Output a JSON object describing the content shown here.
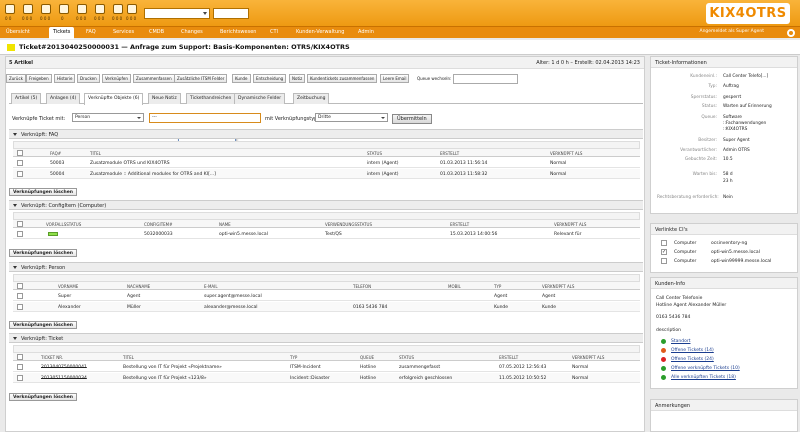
{
  "toolbar": {
    "icons": [
      {
        "name": "locked-tickets-icon",
        "count": "0 0"
      },
      {
        "name": "watched-tickets-icon",
        "count": "0 0 0"
      },
      {
        "name": "responsible-tickets-icon",
        "count": "0 0 0"
      },
      {
        "name": "escalated-tickets-icon",
        "count": "0"
      },
      {
        "name": "new-phone-ticket-icon",
        "count": "0 0 0"
      },
      {
        "name": "new-email-ticket-icon",
        "count": "0 0 0"
      },
      {
        "name": "search-tickets-icon",
        "count": "0 0 0"
      },
      {
        "name": "reminder-tickets-icon",
        "count": "0 0 0"
      }
    ],
    "select_value": "",
    "search_value": ""
  },
  "logo": "KIX4OTRS",
  "nav": {
    "items": [
      "Übersicht",
      "Tickets",
      "FAQ",
      "Services",
      "CMDB",
      "Changes",
      "Berichtswesen",
      "CTI",
      "Kunden-Verwaltung",
      "Admin"
    ],
    "active": "Tickets",
    "user": "Angemeldet als Super Agent"
  },
  "ticket": {
    "title": "Ticket#2013040250000031 — Anfrage zum Support: Basis-Komponenten: OTRS/KIX4OTRS",
    "articles_label": "5 Artikel",
    "age_info": "Alter: 1 d 0 h – Erstellt: 02.04.2013 14:23"
  },
  "actions": [
    "Zurück",
    "Freigeben",
    "Historie",
    "Drucken",
    "Verknüpfen",
    "Zusammenfassen",
    "Zusätzliche ITSM Felder",
    "Kunde",
    "Entscheidung",
    "Notiz",
    "Kundentickets zusammenfassen",
    "Leere Email"
  ],
  "queue": {
    "label": "Queue wechseln:",
    "value": ""
  },
  "tabs": [
    "Artikel (5)",
    "Anlagen (4)",
    "Verknüpfte Objekte (6)",
    "Neue Notiz",
    "Tickethandreichen",
    "Dynamische Felder",
    "Zeitbuchung"
  ],
  "active_tab": "Verknüpfte Objekte (6)",
  "link": {
    "label": "Verknüpfe Ticket mit:",
    "object": "Person",
    "search_value": "---",
    "type_label": "mit Verknüpfungstyp:",
    "type": "Dritte",
    "submit": "Übermitteln",
    "tooltip": "Ticket verknüpfen"
  },
  "delete_label": "Verknüpfungen löschen",
  "sections": {
    "faq": {
      "title": "Verknüpft: FAQ",
      "headers": [
        "FAQ#",
        "TITEL",
        "STATUS",
        "ERSTELLT",
        "VERKNÜPFT ALS"
      ],
      "rows": [
        [
          "50003",
          "Zusatzmodule OTRS und KIX4OTRS",
          "intern (Agent)",
          "01.03.2013 11:56:14",
          "Normal"
        ],
        [
          "50004",
          "Zusatzmodule :: Additional modules for OTRS and KI[...]",
          "intern (Agent)",
          "01.03.2013 11:58:32",
          "Normal"
        ]
      ]
    },
    "configitem": {
      "title": "Verknüpft: ConfigItem (Computer)",
      "headers": [
        "VORFALLSSTATUS",
        "CONFIGITEM#",
        "NAME",
        "VERWENDUNGSSTATUS",
        "ERSTELLT",
        "VERKNÜPFT ALS"
      ],
      "rows": [
        [
          "",
          "5032000033",
          "opti-win5.messe.local",
          "Test/QS",
          "15.03.2013 14:00:56",
          "Relevant für"
        ]
      ]
    },
    "person": {
      "title": "Verknüpft: Person",
      "headers": [
        "VORNAME",
        "NACHNAME",
        "E-MAIL",
        "TELEFON",
        "MOBIL",
        "TYP",
        "VERKNÜPFT ALS"
      ],
      "rows": [
        [
          "Super",
          "Agent",
          "super.agent@messe.local",
          "",
          "",
          "Agent",
          "Agent"
        ],
        [
          "Alexander",
          "Müller",
          "alexander@messe.local",
          "0163 5436 784",
          "",
          "Kunde",
          "Kunde"
        ]
      ]
    },
    "ticket": {
      "title": "Verknüpft: Ticket",
      "headers": [
        "TICKET NR.",
        "TITEL",
        "TYP",
        "QUEUE",
        "STATUS",
        "ERSTELLT",
        "VERKNÜPFT ALS"
      ],
      "rows": [
        [
          "2013040750000041",
          "Bestellung von IT für Projekt «Projektname»",
          "ITSM-Incident",
          "Hotline",
          "zusammengefasst",
          "07.05.2012 12:56:43",
          "Normal"
        ],
        [
          "2013051150000034",
          "Bestellung von IT für Projekt «123/8»",
          "Incident::Disaster",
          "Hotline",
          "erfolgreich geschlossen",
          "11.05.2012 10:50:52",
          "Normal"
        ]
      ]
    }
  },
  "side": {
    "info": {
      "title": "Ticket-Informationen",
      "rows": [
        {
          "k": "Kundeneinl.:",
          "v": "Call Center Telefo[...]"
        },
        {
          "k": "Typ:",
          "v": "Auftrag"
        },
        {
          "k": "Sperrstatus:",
          "v": "gesperrt"
        },
        {
          "k": "Status:",
          "v": "Warten auf Erinnerung"
        },
        {
          "k": "Queue:",
          "v": "Software"
        },
        {
          "k": "",
          "v": "::Fachanwendungen"
        },
        {
          "k": "",
          "v": "::KIX4OTRS"
        },
        {
          "k": "Besitzer:",
          "v": "Super Agent"
        },
        {
          "k": "Verantwortlicher:",
          "v": "Admin OTRS"
        },
        {
          "k": "Gebuchte Zeit:",
          "v": "10.5"
        },
        {
          "k": "Warten bis:",
          "v": "58 d"
        },
        {
          "k": "",
          "v": "23 h"
        },
        {
          "k": "Rechtsberatung erforderlich:",
          "v": "Nein"
        }
      ]
    },
    "cis": {
      "title": "Verlinkte CI's",
      "rows": [
        {
          "type": "Computer",
          "name": "ocsinventory-ng",
          "checked": false
        },
        {
          "type": "Computer",
          "name": "opti-win5.messe.local",
          "checked": true
        },
        {
          "type": "Computer",
          "name": "opti-win99999.messe.local",
          "checked": false
        }
      ]
    },
    "customer": {
      "title": "Kunden-Info",
      "company": "Call Center Telefonie",
      "name": "Hotline Agent Alexander Müller",
      "phone": "0163 5436 784",
      "desc": "description",
      "links": [
        {
          "label": "Standort",
          "color": "#2a9d2a"
        },
        {
          "label": "Offene Tickets (14)",
          "color": "#e05a1a"
        },
        {
          "label": "Offene Tickets (24)",
          "color": "#d22"
        },
        {
          "label": "Offene verknüpfte Tickets (10)",
          "color": "#2a9d2a"
        },
        {
          "label": "Alle verknüpften Tickets (18)",
          "color": "#2a9d2a"
        }
      ]
    },
    "notes": {
      "title": "Anmerkungen"
    }
  }
}
